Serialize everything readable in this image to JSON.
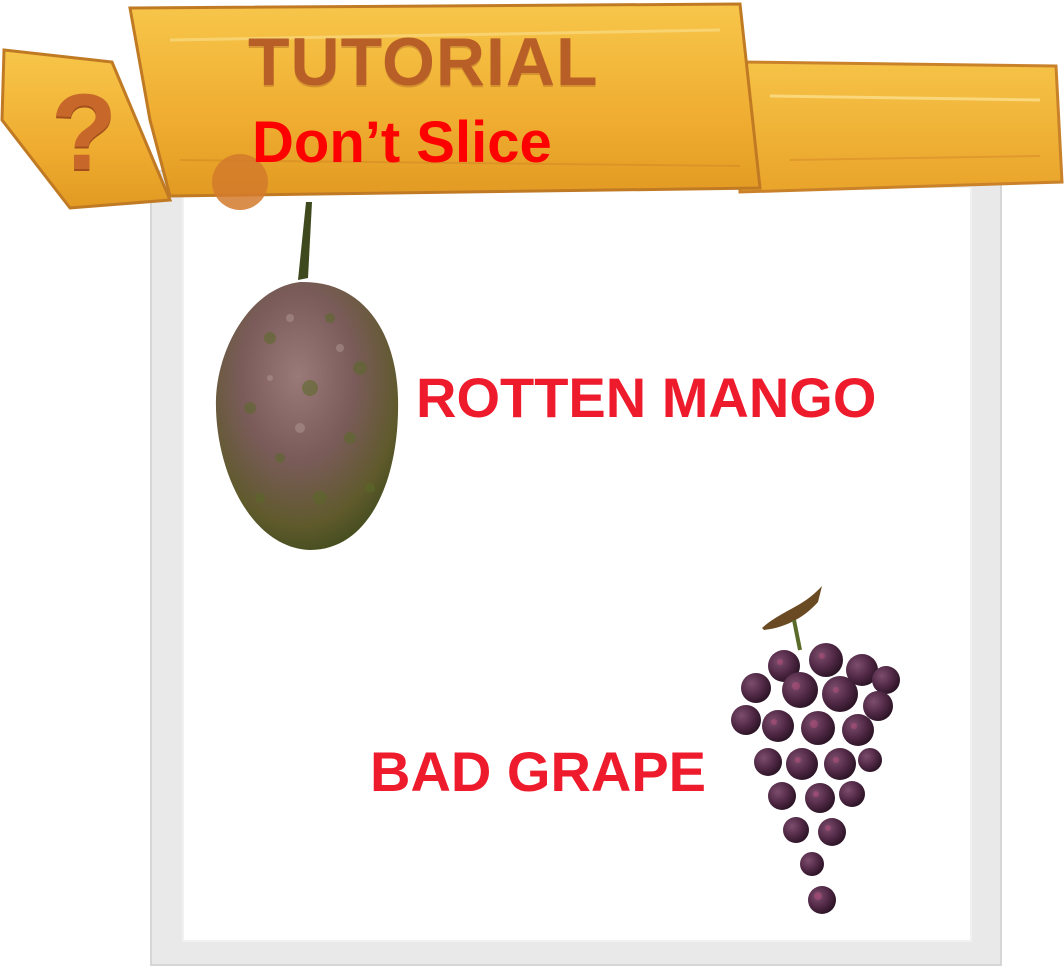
{
  "header": {
    "help_symbol": "?",
    "title": "TUTORIAL",
    "subtitle": "Don’t Slice"
  },
  "items": [
    {
      "label": "ROTTEN MANGO",
      "icon": "rotten-mango-icon"
    },
    {
      "label": "BAD GRAPE",
      "icon": "bad-grape-icon"
    }
  ],
  "colors": {
    "banner_gold": "#f2b53a",
    "banner_text": "#b85e27",
    "subtitle_red": "#ff0000",
    "label_red": "#ee1b2d",
    "panel_gray": "#e9e9e9"
  }
}
